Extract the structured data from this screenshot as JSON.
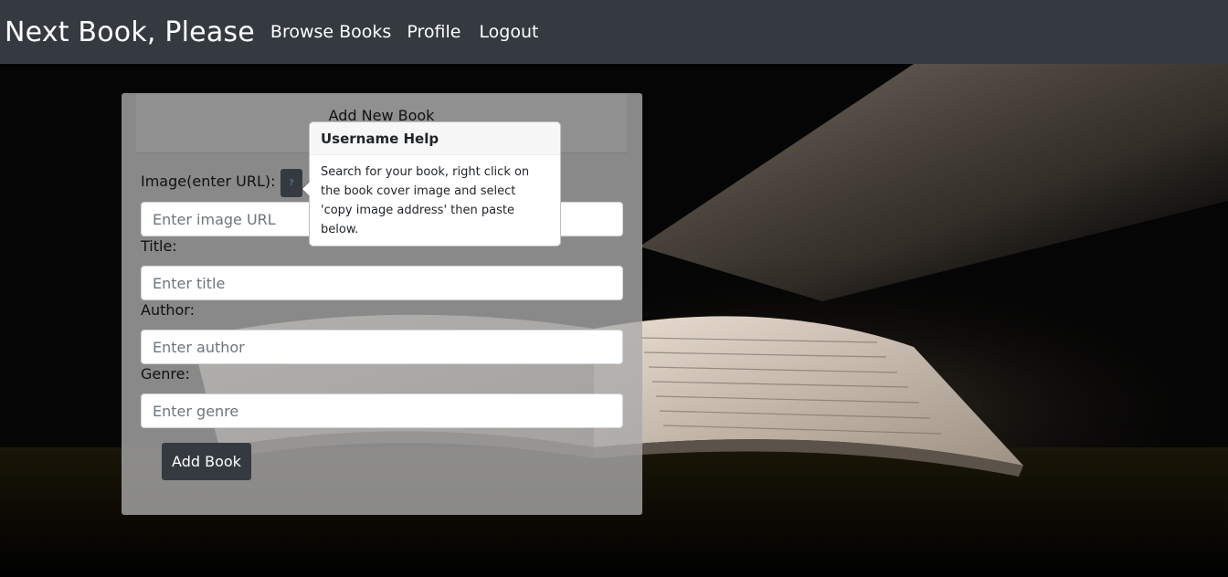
{
  "nav": {
    "brand": "Next Book, Please",
    "links": [
      "Browse Books",
      "Profile",
      "Logout"
    ]
  },
  "form": {
    "title": "Add New Book",
    "help_button": "?",
    "fields": [
      {
        "label": "Image(enter URL):",
        "placeholder": "Enter image URL"
      },
      {
        "label": "Title:",
        "placeholder": "Enter title"
      },
      {
        "label": "Author:",
        "placeholder": "Enter author"
      },
      {
        "label": "Genre:",
        "placeholder": "Enter genre"
      }
    ],
    "submit_label": "Add Book"
  },
  "popover": {
    "title": "Username Help",
    "body": "Search for your book, right click on the book cover image and select 'copy image address' then paste below."
  },
  "colors": {
    "navbar": "#343a40",
    "button": "#343a40",
    "card": "#aaaaaa",
    "help_icon": "#4aa3df"
  },
  "icons": {
    "help": "question-mark-icon"
  }
}
